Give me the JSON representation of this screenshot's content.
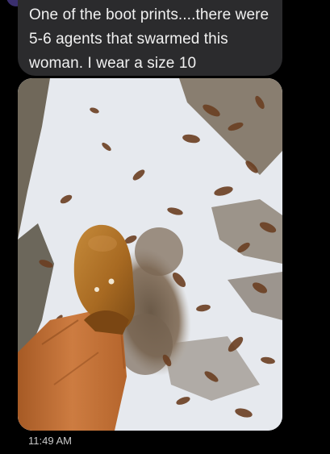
{
  "message": {
    "text": "One of the boot prints....there were 5-6 agents that swarmed this woman. I wear a size 10",
    "timestamp": "11:49 AM"
  },
  "photo": {
    "subject": "brown suede clog and orange pants leg beside a boot print in patchy snow with dead leaves"
  },
  "colors": {
    "background": "#000000",
    "bubble": "#2b2b2d",
    "text": "#f1f1f1",
    "timestamp": "#c9c9c9",
    "snow": "#e6e9ee",
    "clog": "#a86a22",
    "pants": "#c8763a"
  }
}
